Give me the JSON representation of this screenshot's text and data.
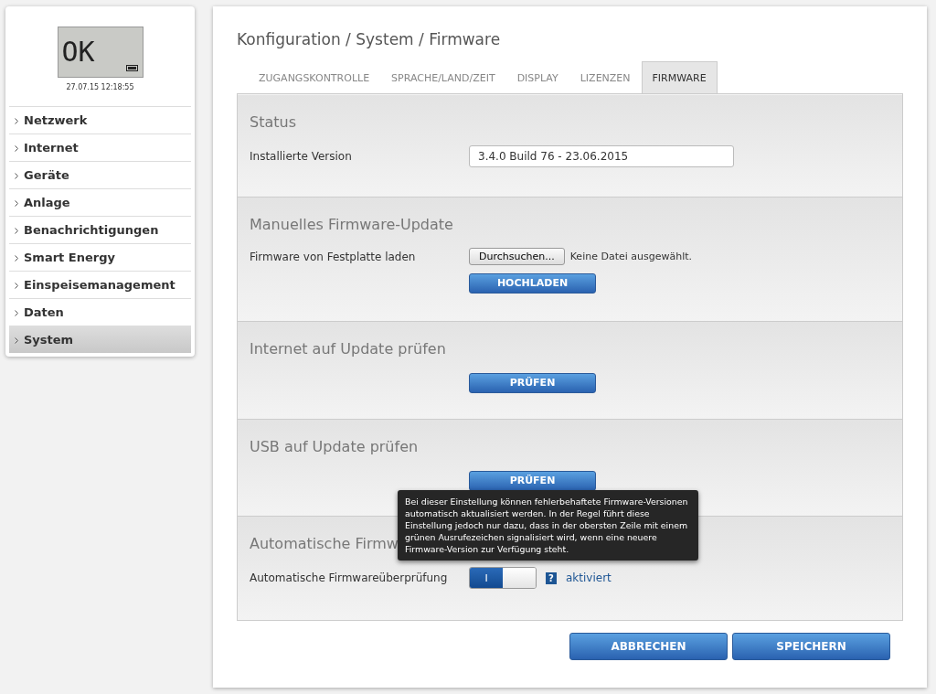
{
  "device": {
    "display": "OK",
    "timestamp": "27.07.15 12:18:55"
  },
  "sidebar": {
    "items": [
      {
        "label": "Netzwerk",
        "selected": false
      },
      {
        "label": "Internet",
        "selected": false
      },
      {
        "label": "Geräte",
        "selected": false
      },
      {
        "label": "Anlage",
        "selected": false
      },
      {
        "label": "Benachrichtigungen",
        "selected": false
      },
      {
        "label": "Smart Energy",
        "selected": false
      },
      {
        "label": "Einspeisemanagement",
        "selected": false
      },
      {
        "label": "Daten",
        "selected": false
      },
      {
        "label": "System",
        "selected": true
      }
    ]
  },
  "breadcrumb": "Konfiguration / System / Firmware",
  "tabs": [
    {
      "label": "ZUGANGSKONTROLLE",
      "selected": false
    },
    {
      "label": "SPRACHE/LAND/ZEIT",
      "selected": false
    },
    {
      "label": "DISPLAY",
      "selected": false
    },
    {
      "label": "LIZENZEN",
      "selected": false
    },
    {
      "label": "FIRMWARE",
      "selected": true
    }
  ],
  "sections": [
    {
      "kind": "field",
      "title": "Status",
      "label": "Installierte Version",
      "value": "3.4.0 Build 76 - 23.06.2015"
    },
    {
      "kind": "upload",
      "title": "Manuelles Firmware-Update",
      "label": "Firmware von Festplatte laden",
      "browse": "Durchsuchen...",
      "file": "Keine Datei ausgewählt.",
      "button": "HOCHLADEN"
    },
    {
      "kind": "check",
      "title": "Internet auf Update prüfen",
      "button": "PRÜFEN"
    },
    {
      "kind": "check",
      "title": "USB auf Update prüfen",
      "button": "PRÜFEN"
    },
    {
      "kind": "toggle",
      "title": "Automatische Firmw",
      "label": "Automatische Firmwareüberprüfung",
      "toggle": {
        "on": true,
        "label": "I"
      },
      "help": "?",
      "status": "aktiviert",
      "tooltip": "Bei dieser Einstellung können fehlerbehaftete Firmware-Versionen automatisch aktualisiert werden. In der Regel führt diese Einstellung jedoch nur dazu, dass in der obersten Zeile mit einem grünen Ausrufezeichen signalisiert wird, wenn eine neuere Firmware-Version zur Verfügung steht."
    }
  ],
  "actions": [
    "ABBRECHEN",
    "SPEICHERN"
  ]
}
